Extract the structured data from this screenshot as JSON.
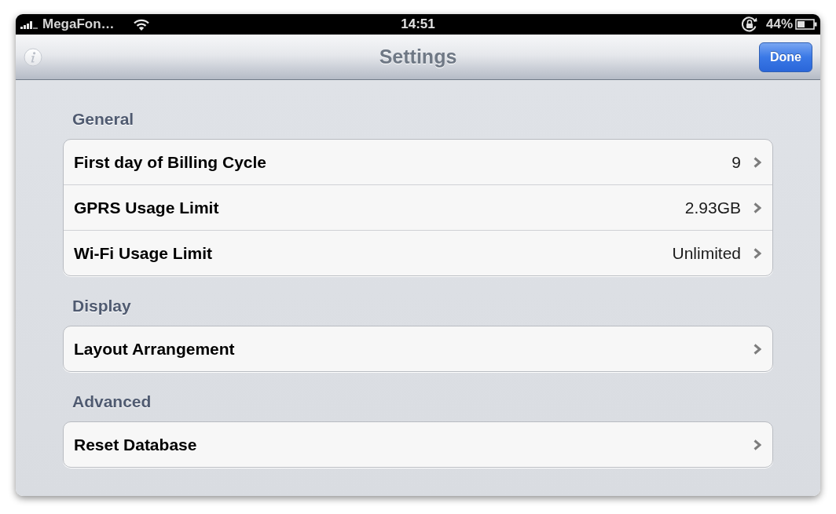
{
  "status_bar": {
    "carrier": "MegaFon…",
    "time": "14:51",
    "battery": "44%"
  },
  "nav_bar": {
    "title": "Settings",
    "done_button": "Done"
  },
  "sections": [
    {
      "header": "General",
      "rows": [
        {
          "label": "First day of Billing Cycle",
          "value": "9"
        },
        {
          "label": "GPRS Usage Limit",
          "value": "2.93GB"
        },
        {
          "label": "Wi-Fi Usage Limit",
          "value": "Unlimited"
        }
      ]
    },
    {
      "header": "Display",
      "rows": [
        {
          "label": "Layout Arrangement"
        }
      ]
    },
    {
      "header": "Advanced",
      "rows": [
        {
          "label": "Reset Database"
        }
      ]
    }
  ]
}
